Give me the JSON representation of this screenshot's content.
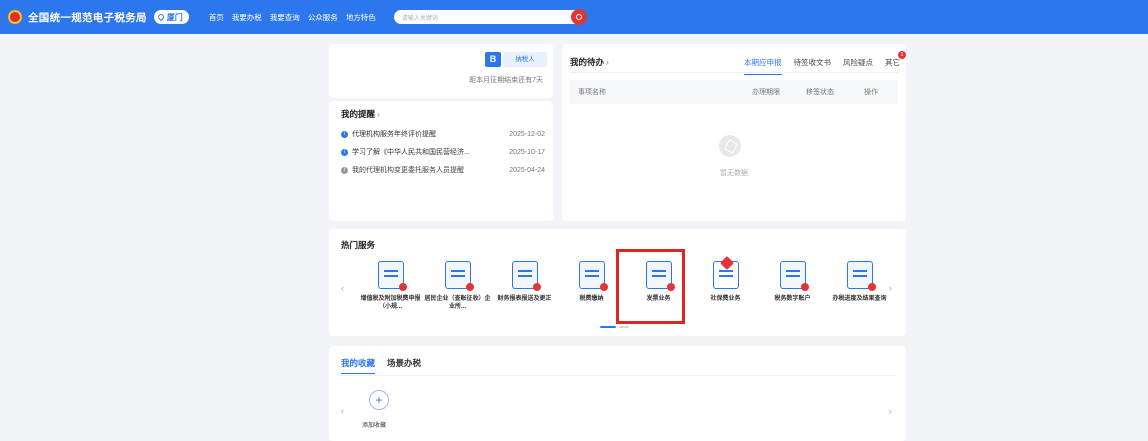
{
  "header": {
    "title": "全国统一规范电子税务局",
    "region": "厦门",
    "nav": [
      "首页",
      "我要办税",
      "我要查询",
      "公众服务",
      "地方特色"
    ],
    "search_placeholder": "请输入关键词"
  },
  "user": {
    "badge": "B",
    "role": "纳税人",
    "deadline": "距本月征期结束还有7天"
  },
  "reminders": {
    "title": "我的提醒",
    "items": [
      {
        "text": "代理机构服务年终评价提醒",
        "date": "2025-12-02"
      },
      {
        "text": "学习了解《中华人民共和国民营经济...",
        "date": "2025-10-17"
      },
      {
        "text": "我的代理机构变更委托服务人员提醒",
        "date": "2025-04-24"
      }
    ]
  },
  "todo": {
    "title": "我的待办",
    "tabs": [
      "本期应申报",
      "待签收文书",
      "风险疑点",
      "其它"
    ],
    "other_badge": "1",
    "columns": [
      "事项名称",
      "办理期限",
      "移签状态",
      "操作"
    ],
    "empty": "暂无数据"
  },
  "hot": {
    "title": "热门服务",
    "services": [
      {
        "label": "增值税及附加税费申报（小规..."
      },
      {
        "label": "居民企业（查账征收）企业所..."
      },
      {
        "label": "财务报表报送及更正"
      },
      {
        "label": "税费缴纳"
      },
      {
        "label": "发票业务"
      },
      {
        "label": "社保费业务"
      },
      {
        "label": "税务数字账户"
      },
      {
        "label": "办税进度及结果查询"
      }
    ]
  },
  "favorites": {
    "tabs": [
      "我的收藏",
      "场景办税"
    ],
    "add_label": "添加收藏"
  },
  "colors": {
    "primary": "#2d77ee",
    "danger": "#e23636",
    "background": "#f2f4f7"
  }
}
